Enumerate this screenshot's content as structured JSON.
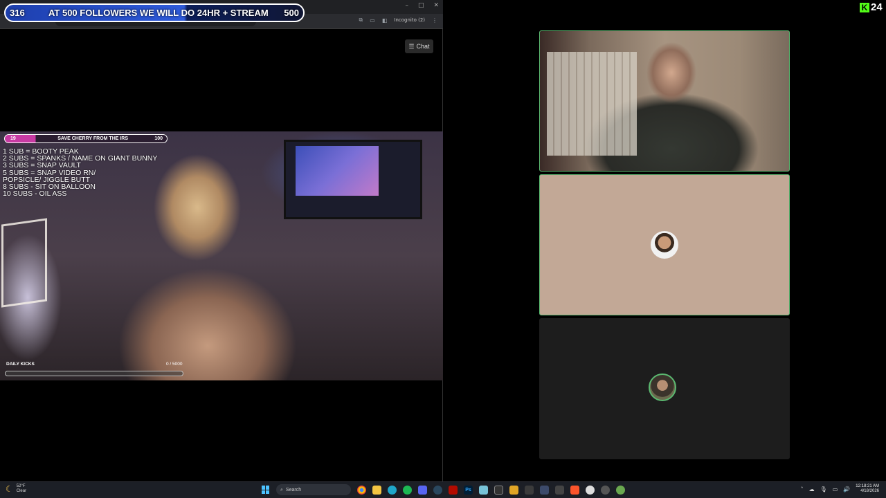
{
  "browser": {
    "window_controls": [
      "–",
      "□",
      "✕"
    ],
    "incognito_label": "Incognito (2)",
    "chat_button": "Chat"
  },
  "follower_goal": {
    "current": "316",
    "text": "AT 500 FOLLOWERS WE WILL DO 24HR + STREAM",
    "target": "500",
    "progress_fraction": 0.632
  },
  "stream": {
    "sub_goal": {
      "current": "19",
      "text": "SAVE CHERRY FROM THE IRS",
      "target": "100",
      "progress_fraction": 0.19
    },
    "sub_rewards": [
      "1 SUB =  BOOTY PEAK",
      "2 SUBS = SPANKS / NAME ON GIANT BUNNY",
      "3 SUBS = SNAP VAULT",
      "5 SUBS =  SNAP VIDEO RN/",
      "POPSICLE/ JIGGLE BUTT",
      "8 SUBS - SIT ON BALLOON",
      "10 SUBS - OIL ASS"
    ],
    "daily_kicks_label": "DAILY KICKS",
    "daily_kicks_count": "0 / 5000",
    "daily_kicks_fraction": 0.0
  },
  "right_panel": {
    "logo_k": "K",
    "logo_number": "24"
  },
  "taskbar": {
    "weather_temp": "52°F",
    "weather_desc": "Clear",
    "search_placeholder": "Search",
    "apps": [
      "chrome",
      "files",
      "edge",
      "spotify",
      "discord",
      "steam",
      "acrobat",
      "photoshop",
      "notepad",
      "terminal",
      "notes",
      "obs",
      "vpn",
      "headset",
      "brave",
      "circle",
      "tool",
      "globe"
    ],
    "clock_time": "12:18:21 AM",
    "clock_date": "4/18/2026"
  },
  "colors": {
    "kick_green": "#53fc18",
    "tile_border": "#5bb870",
    "goal_blue": "#2f5bdb",
    "sub_pink": "#c83aa3"
  }
}
